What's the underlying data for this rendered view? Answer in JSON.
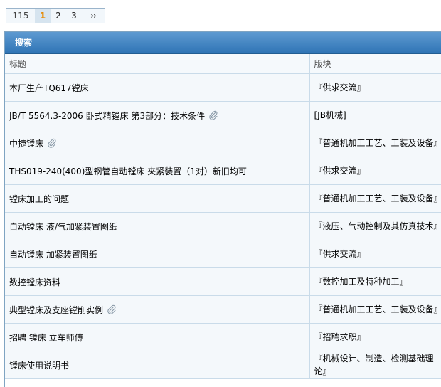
{
  "pagination": {
    "total": "115",
    "current": "1",
    "pages": [
      "2",
      "3"
    ],
    "next_label": "››"
  },
  "panel": {
    "title": "搜索"
  },
  "table": {
    "headers": {
      "title": "标题",
      "forum": "版块"
    },
    "rows": [
      {
        "title": "本厂生产TQ617镗床",
        "forum": "『供求交流』",
        "attachment": false
      },
      {
        "title": "JB/T 5564.3-2006 卧式精镗床 第3部分：技术条件",
        "forum": "[JB机械]",
        "attachment": true
      },
      {
        "title": "中捷镗床",
        "forum": "『普通机加工工艺、工装及设备』",
        "attachment": true
      },
      {
        "title": "THS019-240(400)型钢管自动镗床 夹紧装置（1对）新旧均可",
        "forum": "『供求交流』",
        "attachment": false
      },
      {
        "title": "镗床加工的问题",
        "forum": "『普通机加工工艺、工装及设备』",
        "attachment": false
      },
      {
        "title": "自动镗床 液/气加紧装置图纸",
        "forum": "『液压、气动控制及其仿真技术』",
        "attachment": false
      },
      {
        "title": "自动镗床 加紧装置图纸",
        "forum": "『供求交流』",
        "attachment": false
      },
      {
        "title": "数控镗床资料",
        "forum": "『数控加工及特种加工』",
        "attachment": false
      },
      {
        "title": "典型镗床及支座镗削实例",
        "forum": "『普通机加工工艺、工装及设备』",
        "attachment": true
      },
      {
        "title": "招聘 镗床 立车师傅",
        "forum": "『招聘求职』",
        "attachment": false
      },
      {
        "title": "镗床使用说明书",
        "forum": "『机械设计、制造、检测基础理论』",
        "attachment": false
      }
    ]
  },
  "icons": {
    "attachment": "paperclip-icon"
  },
  "colors": {
    "header_bg": "#2f74b5",
    "current_page": "#e78a00",
    "row_bg": "#f4f8fb",
    "border": "#c9dbe9"
  }
}
